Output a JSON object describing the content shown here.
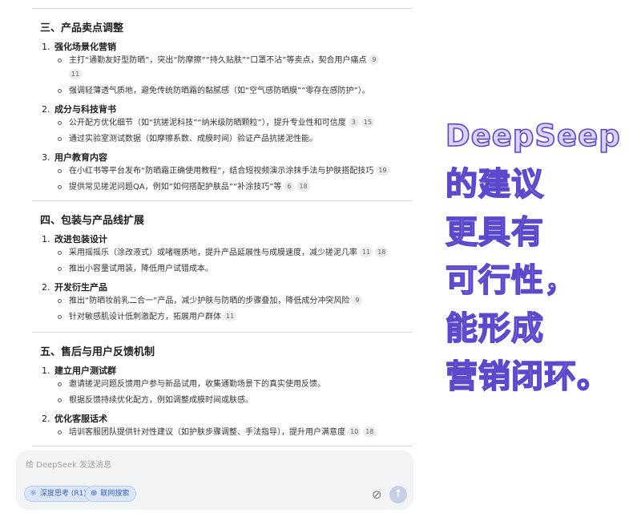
{
  "sections": [
    {
      "title": "三、产品卖点调整",
      "subsections": [
        {
          "number": "1.",
          "title": "强化场景化营销",
          "bullets": [
            {
              "text": "主打“通勤友好型防晒”，突出“防摩擦”“持久贴肤”“口罩不沾”等卖点，契合用户痛点",
              "cites": [
                "9",
                "11"
              ]
            },
            {
              "text": "强调轻薄透气质地，避免传统防晒霜的黏腻感（如“空气感防晒膜”“零存在感防护”）。",
              "cites": []
            }
          ]
        },
        {
          "number": "2.",
          "title": "成分与科技背书",
          "bullets": [
            {
              "text": "公开配方优化细节（如“抗搓泥科技”“纳米级防晒颗粒”），提升专业性和可信度",
              "cites": [
                "3",
                "15"
              ]
            },
            {
              "text": "通过实验室测试数据（如摩擦系数、成膜时间）验证产品抗搓泥性能。",
              "cites": []
            }
          ]
        },
        {
          "number": "3.",
          "title": "用户教育内容",
          "bullets": [
            {
              "text": "在小红书等平台发布“防晒霜正确使用教程”，结合短视频演示涂抹手法与护肤搭配技巧",
              "cites": [
                "19"
              ]
            },
            {
              "text": "提供常见搓泥问题QA，例如“如何搭配护肤品”“补涂技巧”等",
              "cites": [
                "6",
                "18"
              ]
            }
          ]
        }
      ]
    },
    {
      "title": "四、包装与产品线扩展",
      "subsections": [
        {
          "number": "1.",
          "title": "改进包装设计",
          "bullets": [
            {
              "text": "采用摇摇乐（涂改液式）或啫喱质地，提升产品延展性与成膜速度，减少搓泥几率",
              "cites": [
                "11",
                "18"
              ]
            },
            {
              "text": "推出小容量试用装，降低用户试错成本。",
              "cites": []
            }
          ]
        },
        {
          "number": "2.",
          "title": "开发衍生产品",
          "bullets": [
            {
              "text": "推出“防晒妆前乳二合一”产品，减少护肤与防晒的步骤叠加，降低成分冲突风险",
              "cites": [
                "9"
              ]
            },
            {
              "text": "针对敏感肌设计低刺激配方，拓展用户群体",
              "cites": [
                "11"
              ]
            }
          ]
        }
      ]
    },
    {
      "title": "五、售后与用户反馈机制",
      "subsections": [
        {
          "number": "1.",
          "title": "建立用户测试群",
          "bullets": [
            {
              "text": "邀请搓泥问题反馈用户参与新品试用，收集通勤场景下的真实使用反馈。",
              "cites": []
            },
            {
              "text": "根据反馈持续优化配方，例如调整成膜时间或肤感。",
              "cites": []
            }
          ]
        },
        {
          "number": "2.",
          "title": "优化客服话术",
          "bullets": [
            {
              "text": "培训客服团队提供针对性建议（如护肤步骤调整、手法指导），提升用户满意度",
              "cites": [
                "10",
                "18"
              ]
            }
          ]
        }
      ]
    }
  ],
  "chat": {
    "placeholder": "给 DeepSeek 发送消息",
    "deep_think_label": "深度思考 (R1)",
    "web_search_label": "联网搜索"
  },
  "overlay_lines": [
    "DeepSeep",
    "的建议",
    "更具有",
    "可行性，",
    "能形成",
    "营销闭环。"
  ],
  "colors": {
    "overlay_fill": "#ddd2f3",
    "overlay_stroke": "#5a49cc",
    "chip_bg": "#dbe6fb",
    "chip_text": "#3b63c9"
  }
}
